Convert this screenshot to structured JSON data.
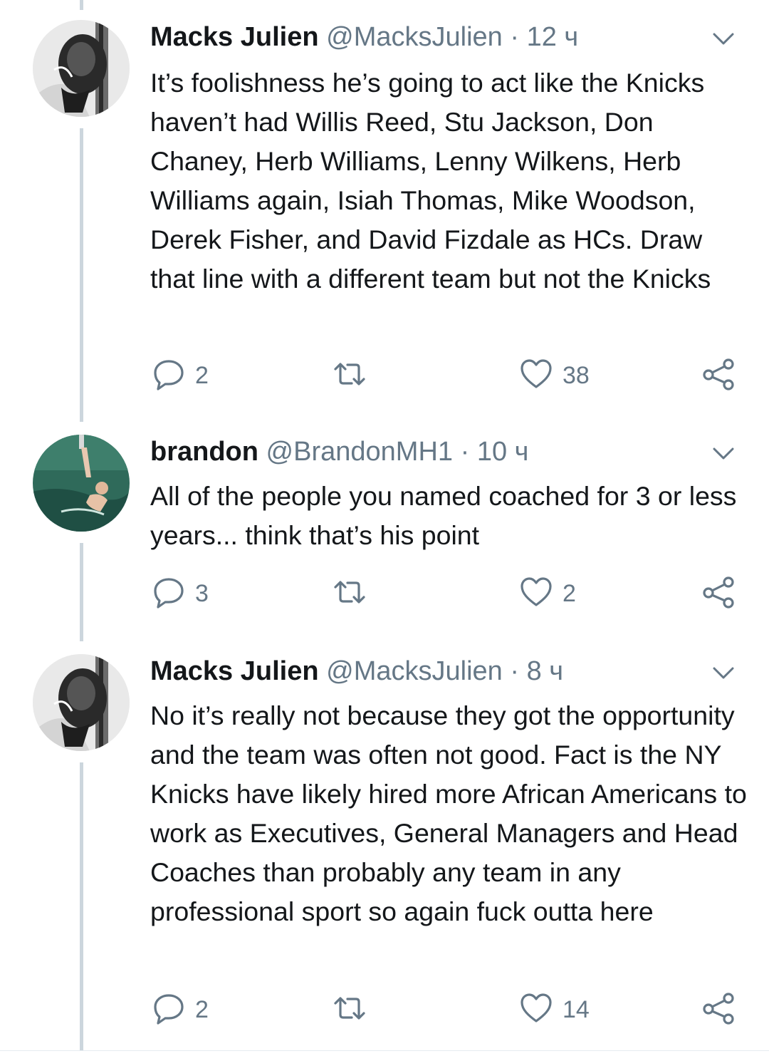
{
  "colors": {
    "text": "#14171a",
    "muted": "#657786",
    "thread": "#ccd6dd"
  },
  "tweets": [
    {
      "name": "Macks Julien",
      "handle": "@MacksJulien",
      "separator": "·",
      "time": "12 ч",
      "text": "It’s foolishness he’s going to act like the Knicks haven’t had Willis Reed, Stu Jackson, Don Chaney, Herb Williams, Lenny Wilkens, Herb Williams again, Isiah Thomas, Mike Woodson, Derek Fisher, and David Fizdale as HCs. Draw that line with a different team but not the Knicks",
      "replies": "2",
      "retweets": "",
      "likes": "38",
      "icons": {
        "reply": "reply-icon",
        "retweet": "retweet-icon",
        "like": "heart-icon",
        "share": "share-icon",
        "menu": "chevron-down-icon"
      }
    },
    {
      "name": "brandon",
      "handle": "@BrandonMH1",
      "separator": "·",
      "time": "10 ч",
      "text": "All of the people you named coached for 3 or less years... think that’s his point",
      "replies": "3",
      "retweets": "",
      "likes": "2",
      "icons": {
        "reply": "reply-icon",
        "retweet": "retweet-icon",
        "like": "heart-icon",
        "share": "share-icon",
        "menu": "chevron-down-icon"
      }
    },
    {
      "name": "Macks Julien",
      "handle": "@MacksJulien",
      "separator": "·",
      "time": "8 ч",
      "text": "No it’s really not because they got the opportunity and the team was often not good. Fact is the NY Knicks have likely hired more African Americans to work as Executives, General Managers and Head Coaches than probably any team in any professional sport so again fuck outta here",
      "replies": "2",
      "retweets": "",
      "likes": "14",
      "icons": {
        "reply": "reply-icon",
        "retweet": "retweet-icon",
        "like": "heart-icon",
        "share": "share-icon",
        "menu": "chevron-down-icon"
      }
    }
  ]
}
